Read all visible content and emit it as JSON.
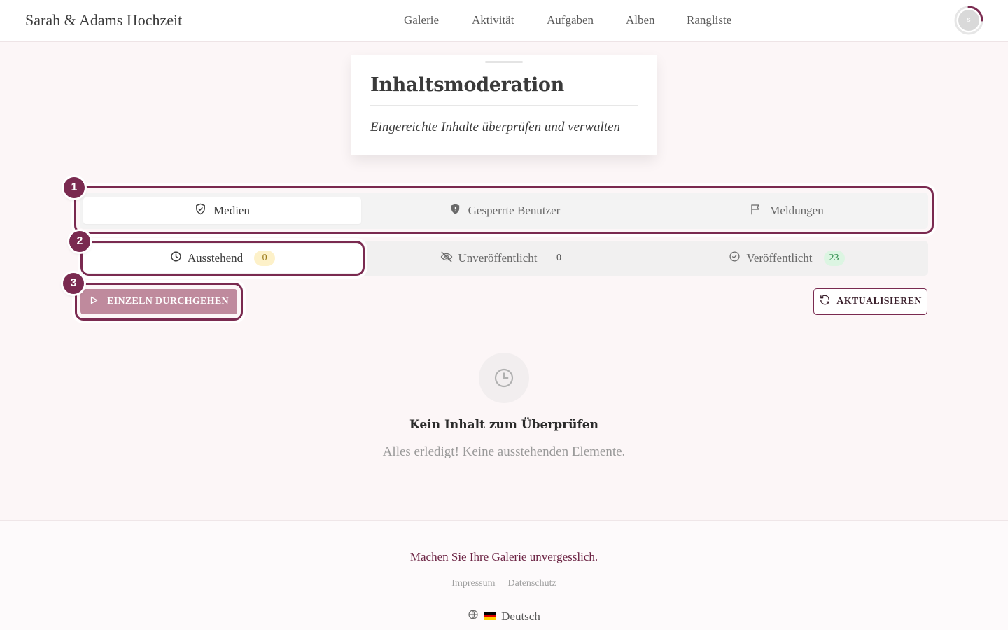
{
  "header": {
    "brand": "Sarah & Adams Hochzeit",
    "nav": [
      {
        "label": "Galerie"
      },
      {
        "label": "Aktivität"
      },
      {
        "label": "Aufgaben"
      },
      {
        "label": "Alben"
      },
      {
        "label": "Rangliste"
      }
    ],
    "avatar_initial": "s"
  },
  "title_card": {
    "title": "Inhaltsmoderation",
    "subtitle": "Eingereichte Inhalte überprüfen und verwalten"
  },
  "tabs_primary": [
    {
      "label": "Medien",
      "icon": "shield-check-icon",
      "active": true
    },
    {
      "label": "Gesperrte Benutzer",
      "icon": "shield-filled-icon",
      "active": false
    },
    {
      "label": "Meldungen",
      "icon": "flag-icon",
      "active": false
    }
  ],
  "tabs_status": [
    {
      "label": "Ausstehend",
      "icon": "clock-icon",
      "count": "0",
      "active": true
    },
    {
      "label": "Unveröffentlicht",
      "icon": "eye-off-icon",
      "count": "0",
      "active": false
    },
    {
      "label": "Veröffentlicht",
      "icon": "check-circle-icon",
      "count": "23",
      "active": false
    }
  ],
  "markers": [
    "1",
    "2",
    "3"
  ],
  "actions": {
    "step_through": "EINZELN DURCHGEHEN",
    "refresh": "AKTUALISIEREN"
  },
  "empty_state": {
    "icon": "clock-icon",
    "title": "Kein Inhalt zum Überprüfen",
    "subtitle": "Alles erledigt! Keine ausstehenden Elemente."
  },
  "footer": {
    "tagline": "Machen Sie Ihre Galerie unvergesslich.",
    "links": [
      "Impressum",
      "Datenschutz"
    ],
    "language": "Deutsch"
  },
  "colors": {
    "accent": "#7a2a50",
    "background": "#fcf6f7",
    "step_button": "#bf8a9d",
    "badge_pending": "#fdf1c9",
    "badge_published": "#dcf5e2"
  }
}
